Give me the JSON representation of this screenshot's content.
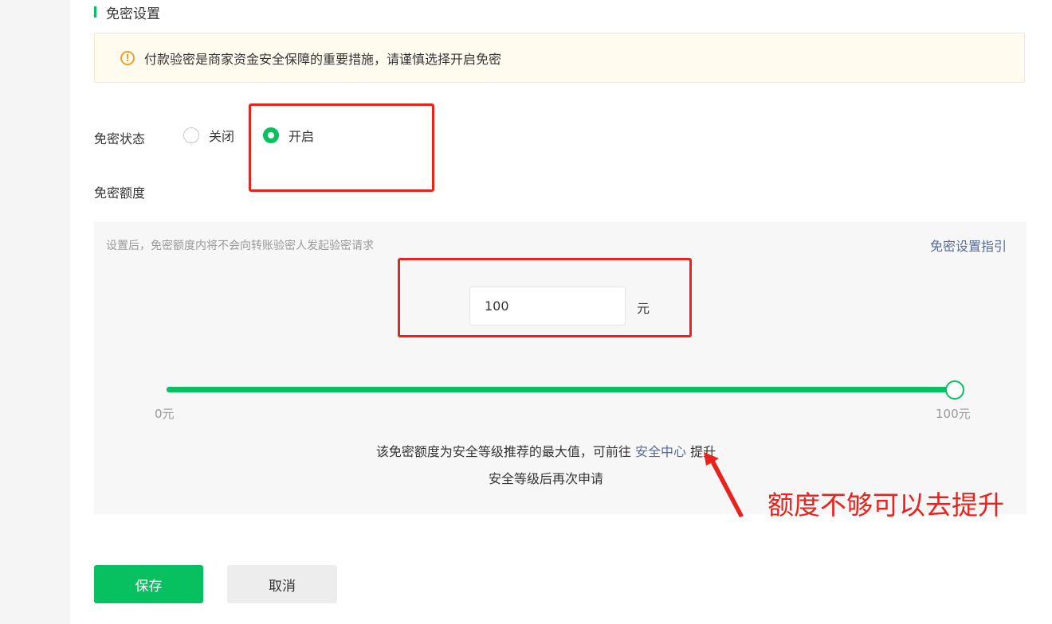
{
  "section_title": "免密设置",
  "notice": {
    "text": "付款验密是商家资金安全保障的重要措施，请谨慎选择开启免密",
    "icon": "warning-circle-icon"
  },
  "status": {
    "label": "免密状态",
    "options": [
      {
        "label": "关闭",
        "selected": false
      },
      {
        "label": "开启",
        "selected": true
      }
    ]
  },
  "quota": {
    "label": "免密额度",
    "hint": "设置后，免密额度内将不会向转账验密人发起验密请求",
    "guide_link": "免密设置指引",
    "amount_value": "100",
    "unit": "元",
    "slider": {
      "min_label": "0元",
      "max_label": "100元",
      "value_fraction": 1.0
    },
    "info_prefix": "该免密额度为安全等级推荐的最大值，可前往 ",
    "info_link": "安全中心",
    "info_suffix": " 提升安全等级后再次申请"
  },
  "buttons": {
    "save": "保存",
    "cancel": "取消"
  },
  "annotation": {
    "text": "额度不够可以去提升"
  },
  "colors": {
    "brand_green": "#07c160",
    "link_blue": "#576b95",
    "annotation_red": "#e8221c",
    "warning_orange": "#f0a02d"
  }
}
